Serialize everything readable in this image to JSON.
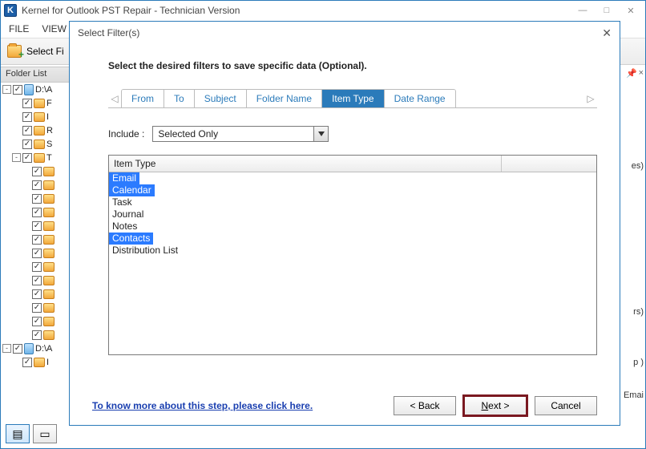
{
  "window": {
    "title": "Kernel for Outlook PST Repair - Technician Version",
    "icon_letter": "K",
    "controls": {
      "min": "—",
      "max": "□",
      "close": "✕"
    }
  },
  "menu": [
    "FILE",
    "VIEW"
  ],
  "toolbar": {
    "select_label": "Select Fi"
  },
  "folder_panel": {
    "header": "Folder List",
    "nodes": [
      {
        "exp": "-",
        "indent": 0,
        "icon": "db",
        "label": "D:\\A"
      },
      {
        "exp": "",
        "indent": 1,
        "icon": "f",
        "label": "F"
      },
      {
        "exp": "",
        "indent": 1,
        "icon": "f",
        "label": "I"
      },
      {
        "exp": "",
        "indent": 1,
        "icon": "f",
        "label": "R"
      },
      {
        "exp": "",
        "indent": 1,
        "icon": "f",
        "label": "S"
      },
      {
        "exp": "-",
        "indent": 1,
        "icon": "f",
        "label": "T"
      },
      {
        "exp": "",
        "indent": 2,
        "icon": "f",
        "label": ""
      },
      {
        "exp": "",
        "indent": 2,
        "icon": "f",
        "label": ""
      },
      {
        "exp": "",
        "indent": 2,
        "icon": "f",
        "label": ""
      },
      {
        "exp": "",
        "indent": 2,
        "icon": "f",
        "label": ""
      },
      {
        "exp": "",
        "indent": 2,
        "icon": "f",
        "label": ""
      },
      {
        "exp": "",
        "indent": 2,
        "icon": "f",
        "label": ""
      },
      {
        "exp": "",
        "indent": 2,
        "icon": "f",
        "label": ""
      },
      {
        "exp": "",
        "indent": 2,
        "icon": "f",
        "label": ""
      },
      {
        "exp": "",
        "indent": 2,
        "icon": "f",
        "label": ""
      },
      {
        "exp": "",
        "indent": 2,
        "icon": "f",
        "label": ""
      },
      {
        "exp": "",
        "indent": 2,
        "icon": "f",
        "label": ""
      },
      {
        "exp": "",
        "indent": 2,
        "icon": "f",
        "label": ""
      },
      {
        "exp": "",
        "indent": 2,
        "icon": "f",
        "label": ""
      },
      {
        "exp": "-",
        "indent": 0,
        "icon": "db",
        "label": "D:\\A"
      },
      {
        "exp": "",
        "indent": 1,
        "icon": "f",
        "label": "I"
      }
    ]
  },
  "side_labels": {
    "s1": "es)",
    "s2": "rs)",
    "s3": "p )",
    "s4": "Emai"
  },
  "dialog": {
    "title": "Select Filter(s)",
    "instruction": "Select the desired filters to save specific data (Optional).",
    "tabs": [
      "From",
      "To",
      "Subject",
      "Folder Name",
      "Item Type",
      "Date Range"
    ],
    "active_tab_index": 4,
    "include_label": "Include  :",
    "include_value": "Selected Only",
    "list_header": "Item Type",
    "items": [
      {
        "label": "Email",
        "selected": true
      },
      {
        "label": "Calendar",
        "selected": true
      },
      {
        "label": "Task",
        "selected": false
      },
      {
        "label": "Journal",
        "selected": false
      },
      {
        "label": "Notes",
        "selected": false
      },
      {
        "label": "Contacts",
        "selected": true
      },
      {
        "label": "Distribution List",
        "selected": false
      }
    ],
    "help_link": "To know more about this step, please click here.",
    "buttons": {
      "back": "< Back",
      "next_prefix": "N",
      "next_rest": "ext >",
      "cancel": "Cancel"
    }
  }
}
